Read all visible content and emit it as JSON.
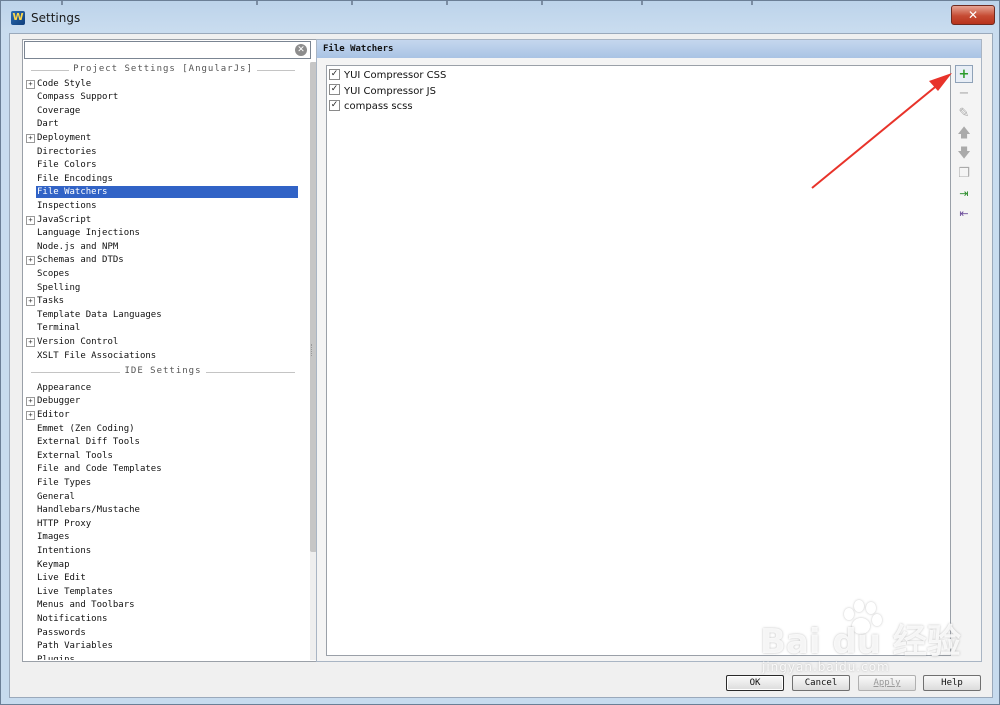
{
  "window": {
    "title": "Settings",
    "close_glyph": "✕",
    "app_icon": "ws-app-icon"
  },
  "search": {
    "value": "",
    "placeholder": ""
  },
  "tree": {
    "project_header": "Project Settings [AngularJs]",
    "project_items": [
      {
        "label": "Code Style",
        "expandable": true
      },
      {
        "label": "Compass Support",
        "expandable": false
      },
      {
        "label": "Coverage",
        "expandable": false
      },
      {
        "label": "Dart",
        "expandable": false
      },
      {
        "label": "Deployment",
        "expandable": true
      },
      {
        "label": "Directories",
        "expandable": false
      },
      {
        "label": "File Colors",
        "expandable": false
      },
      {
        "label": "File Encodings",
        "expandable": false
      },
      {
        "label": "File Watchers",
        "expandable": false,
        "selected": true
      },
      {
        "label": "Inspections",
        "expandable": false
      },
      {
        "label": "JavaScript",
        "expandable": true
      },
      {
        "label": "Language Injections",
        "expandable": false
      },
      {
        "label": "Node.js and NPM",
        "expandable": false
      },
      {
        "label": "Schemas and DTDs",
        "expandable": true
      },
      {
        "label": "Scopes",
        "expandable": false
      },
      {
        "label": "Spelling",
        "expandable": false
      },
      {
        "label": "Tasks",
        "expandable": true
      },
      {
        "label": "Template Data Languages",
        "expandable": false
      },
      {
        "label": "Terminal",
        "expandable": false
      },
      {
        "label": "Version Control",
        "expandable": true
      },
      {
        "label": "XSLT File Associations",
        "expandable": false
      }
    ],
    "ide_header": "IDE Settings",
    "ide_items": [
      {
        "label": "Appearance",
        "expandable": false
      },
      {
        "label": "Debugger",
        "expandable": true
      },
      {
        "label": "Editor",
        "expandable": true
      },
      {
        "label": "Emmet (Zen Coding)",
        "expandable": false
      },
      {
        "label": "External Diff Tools",
        "expandable": false
      },
      {
        "label": "External Tools",
        "expandable": false
      },
      {
        "label": "File and Code Templates",
        "expandable": false
      },
      {
        "label": "File Types",
        "expandable": false
      },
      {
        "label": "General",
        "expandable": false
      },
      {
        "label": "Handlebars/Mustache",
        "expandable": false
      },
      {
        "label": "HTTP Proxy",
        "expandable": false
      },
      {
        "label": "Images",
        "expandable": false
      },
      {
        "label": "Intentions",
        "expandable": false
      },
      {
        "label": "Keymap",
        "expandable": false
      },
      {
        "label": "Live Edit",
        "expandable": false
      },
      {
        "label": "Live Templates",
        "expandable": false
      },
      {
        "label": "Menus and Toolbars",
        "expandable": false
      },
      {
        "label": "Notifications",
        "expandable": false
      },
      {
        "label": "Passwords",
        "expandable": false
      },
      {
        "label": "Path Variables",
        "expandable": false
      },
      {
        "label": "Plugins",
        "expandable": false
      }
    ]
  },
  "panel": {
    "title": "File Watchers",
    "watchers": [
      {
        "label": "YUI Compressor CSS",
        "checked": true
      },
      {
        "label": "YUI Compressor JS",
        "checked": true
      },
      {
        "label": "compass scss",
        "checked": true
      }
    ],
    "toolbar": [
      {
        "name": "add",
        "icon": "plus-icon",
        "glyph": "+",
        "enabled": true
      },
      {
        "name": "remove",
        "icon": "minus-icon",
        "glyph": "−",
        "enabled": false
      },
      {
        "name": "edit",
        "icon": "pencil-icon",
        "glyph": "✎",
        "enabled": false
      },
      {
        "name": "move-up",
        "icon": "arrow-up-icon",
        "glyph": "🡅",
        "enabled": false
      },
      {
        "name": "move-down",
        "icon": "arrow-down-icon",
        "glyph": "🡇",
        "enabled": false
      },
      {
        "name": "copy",
        "icon": "copy-icon",
        "glyph": "❐",
        "enabled": false
      },
      {
        "name": "import",
        "icon": "import-icon",
        "glyph": "⇥",
        "enabled": true
      },
      {
        "name": "export",
        "icon": "export-icon",
        "glyph": "⇤",
        "enabled": true
      }
    ]
  },
  "buttons": {
    "ok": "OK",
    "cancel": "Cancel",
    "apply": "Apply",
    "help": "Help"
  },
  "watermark": {
    "brand": "Bai du 经验",
    "sub": "jingyan.baidu.com"
  },
  "colors": {
    "selection": "#3163c6",
    "header": "#b9cde9",
    "accent_arrow": "#e8332a"
  }
}
